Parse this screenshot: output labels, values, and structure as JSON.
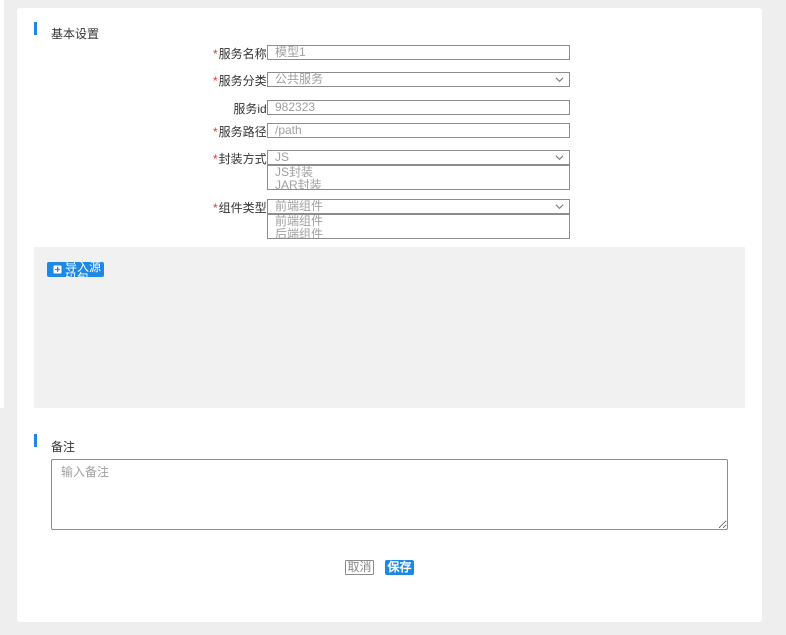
{
  "basic_section": {
    "title": "基本设置"
  },
  "form": {
    "service_name": {
      "label": "服务名称",
      "required": true,
      "value": "模型1"
    },
    "service_category": {
      "label": "服务分类",
      "required": true,
      "value": "公共服务"
    },
    "service_id": {
      "label": "服务id",
      "required": false,
      "value": "982323"
    },
    "service_path": {
      "label": "服务路径",
      "required": true,
      "value": "/path"
    },
    "packaging": {
      "label": "封装方式",
      "required": true,
      "value": "JS",
      "options": [
        "JS封装",
        "JAR封装"
      ]
    },
    "component_type": {
      "label": "组件类型",
      "required": true,
      "value": "前端组件",
      "options": [
        "前端组件",
        "后端组件"
      ]
    }
  },
  "upload": {
    "import_button_label": "导入源码包"
  },
  "remark_section": {
    "title": "备注",
    "placeholder": "输入备注"
  },
  "actions": {
    "cancel_label": "取消",
    "save_label": "保存"
  },
  "colors": {
    "accent": "#1e88e5",
    "required": "#e53935",
    "upload_bg": "#f1f1f1"
  }
}
